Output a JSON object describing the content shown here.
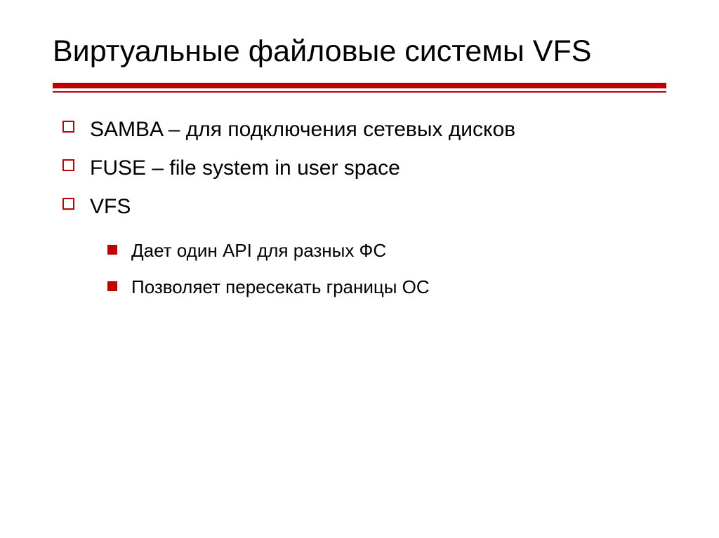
{
  "slide": {
    "title": "Виртуальные файловые системы VFS",
    "items": [
      {
        "text": "SAMBA – для подключения сетевых дисков"
      },
      {
        "text": "FUSE – file system in user space"
      },
      {
        "text": "VFS",
        "subitems": [
          {
            "text": "Дает один API для разных ФС"
          },
          {
            "text": "Позволяет пересекать границы ОС"
          }
        ]
      }
    ]
  },
  "colors": {
    "accent": "#c00000"
  }
}
